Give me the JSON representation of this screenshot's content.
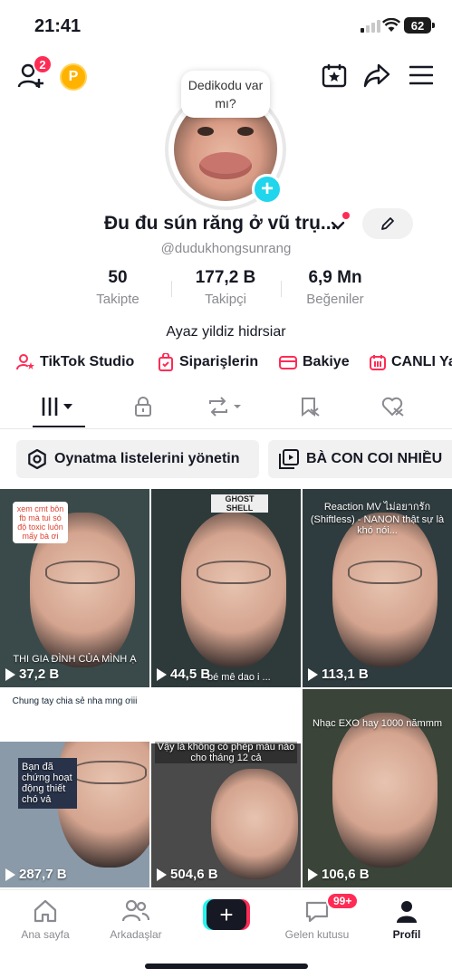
{
  "status_bar": {
    "time": "21:41",
    "battery": "62"
  },
  "top_nav": {
    "notification_count": "2",
    "coin_label": "P"
  },
  "profile": {
    "bubble_text": "Dedikodu var mı?",
    "display_name": "Đu đu sún răng ở vũ trụ...",
    "username": "@dudukhongsunrang",
    "bio": "Ayaz yildiz hidrsiar"
  },
  "stats": [
    {
      "value": "50",
      "label": "Takipte"
    },
    {
      "value": "177,2 B",
      "label": "Takipçi"
    },
    {
      "value": "6,9 Mn",
      "label": "Beğeniler"
    }
  ],
  "links": [
    {
      "label": "TikTok Studio",
      "icon": "studio-icon"
    },
    {
      "label": "Siparişlerin",
      "icon": "orders-icon"
    },
    {
      "label": "Bakiye",
      "icon": "wallet-icon"
    },
    {
      "label": "CANLI Ya",
      "icon": "live-icon"
    }
  ],
  "pills": [
    {
      "label": "Oynatma listelerini yönetin",
      "icon": "gear-icon"
    },
    {
      "label": "BÀ CON COI NHIỀU",
      "icon": "playlist-icon"
    }
  ],
  "videos": [
    {
      "plays": "37,2 B",
      "caption_top": "xem cmt bôn fb mà tui só độ toxic luôn mấy bà ơi",
      "caption_bottom": "THI GIA ĐÌNH CỦA MÌNH Ạ",
      "bg": "#3a4a4a"
    },
    {
      "plays": "44,5 B",
      "caption_top": "GHOST SHELL",
      "caption_bottom": "bé mê dao i ...",
      "bg": "#2e3a3a"
    },
    {
      "plays": "113,1 B",
      "caption_top": "Reaction MV ไม่อยากรัก (Shiftless) - NANON thật sự là khó nói...",
      "caption_bottom": "",
      "bg": "#2f3c3f"
    },
    {
      "plays": "287,7 B",
      "caption_top": "Chung tay chia sẻ nha mng ơiii",
      "caption_bottom": "Bạn đã chứng hoạt động thiết chó vả",
      "bg": "#8a9aa8"
    },
    {
      "plays": "504,6 B",
      "caption_top": "Vậy là không có phép màu nào cho tháng 12 cả",
      "caption_bottom": "",
      "bg": "#4a4a4a"
    },
    {
      "plays": "106,6 B",
      "caption_top": "Nhạc EXO hay 1000 nămmm",
      "caption_bottom": "",
      "bg": "#3a4438"
    }
  ],
  "bottom_nav": [
    {
      "label": "Ana sayfa",
      "icon": "home-icon"
    },
    {
      "label": "Arkadaşlar",
      "icon": "friends-icon"
    },
    {
      "label": "",
      "icon": "create-icon"
    },
    {
      "label": "Gelen kutusu",
      "icon": "inbox-icon",
      "badge": "99+"
    },
    {
      "label": "Profil",
      "icon": "profile-icon"
    }
  ],
  "colors": {
    "accent": "#fe2c55",
    "cyan": "#20d5ec",
    "text": "#161823",
    "muted": "#8a8b91"
  }
}
